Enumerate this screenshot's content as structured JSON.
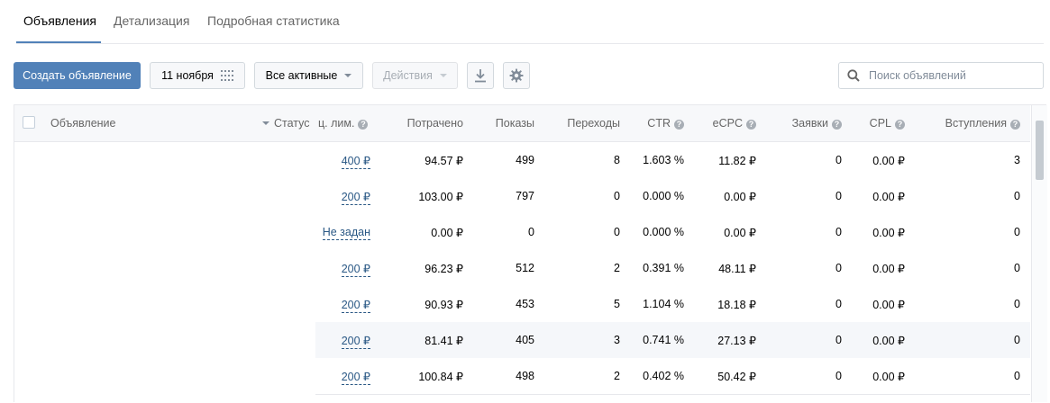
{
  "tabs": [
    "Объявления",
    "Детализация",
    "Подробная статистика"
  ],
  "toolbar": {
    "create_label": "Создать объявление",
    "date_label": "11 ноября",
    "filter_label": "Все активные",
    "actions_label": "Действия",
    "search_placeholder": "Поиск объявлений"
  },
  "icons": {
    "calendar": "calendar-icon",
    "download": "download-icon",
    "settings": "gear-icon",
    "search": "search-icon"
  },
  "table": {
    "headers": {
      "ad": "Объявление",
      "status": "Статус",
      "limit": "ц. лим.",
      "spent": "Потрачено",
      "shows": "Показы",
      "clicks": "Переходы",
      "ctr": "CTR",
      "ecpc": "eCPC",
      "leads": "Заявки",
      "cpl": "CPL",
      "joins": "Вступления"
    },
    "rows": [
      {
        "limit": "400 ₽",
        "spent": "94.57 ₽",
        "shows": "499",
        "clicks": "8",
        "ctr": "1.603 %",
        "ecpc": "11.82 ₽",
        "leads": "0",
        "cpl": "0.00 ₽",
        "joins": "3"
      },
      {
        "limit": "200 ₽",
        "spent": "103.00 ₽",
        "shows": "797",
        "clicks": "0",
        "ctr": "0.000 %",
        "ecpc": "0.00 ₽",
        "leads": "0",
        "cpl": "0.00 ₽",
        "joins": "0"
      },
      {
        "limit": "Не задан",
        "spent": "0.00 ₽",
        "shows": "0",
        "clicks": "0",
        "ctr": "0.000 %",
        "ecpc": "0.00 ₽",
        "leads": "0",
        "cpl": "0.00 ₽",
        "joins": "0"
      },
      {
        "limit": "200 ₽",
        "spent": "96.23 ₽",
        "shows": "512",
        "clicks": "2",
        "ctr": "0.391 %",
        "ecpc": "48.11 ₽",
        "leads": "0",
        "cpl": "0.00 ₽",
        "joins": "0"
      },
      {
        "limit": "200 ₽",
        "spent": "90.93 ₽",
        "shows": "453",
        "clicks": "5",
        "ctr": "1.104 %",
        "ecpc": "18.18 ₽",
        "leads": "0",
        "cpl": "0.00 ₽",
        "joins": "0"
      },
      {
        "limit": "200 ₽",
        "spent": "81.41 ₽",
        "shows": "405",
        "clicks": "3",
        "ctr": "0.741 %",
        "ecpc": "27.13 ₽",
        "leads": "0",
        "cpl": "0.00 ₽",
        "joins": "0"
      },
      {
        "limit": "200 ₽",
        "spent": "100.84 ₽",
        "shows": "498",
        "clicks": "2",
        "ctr": "0.402 %",
        "ecpc": "50.42 ₽",
        "leads": "0",
        "cpl": "0.00 ₽",
        "joins": "0"
      }
    ]
  },
  "colors": {
    "accent": "#5181b8",
    "link": "#2a5885"
  }
}
